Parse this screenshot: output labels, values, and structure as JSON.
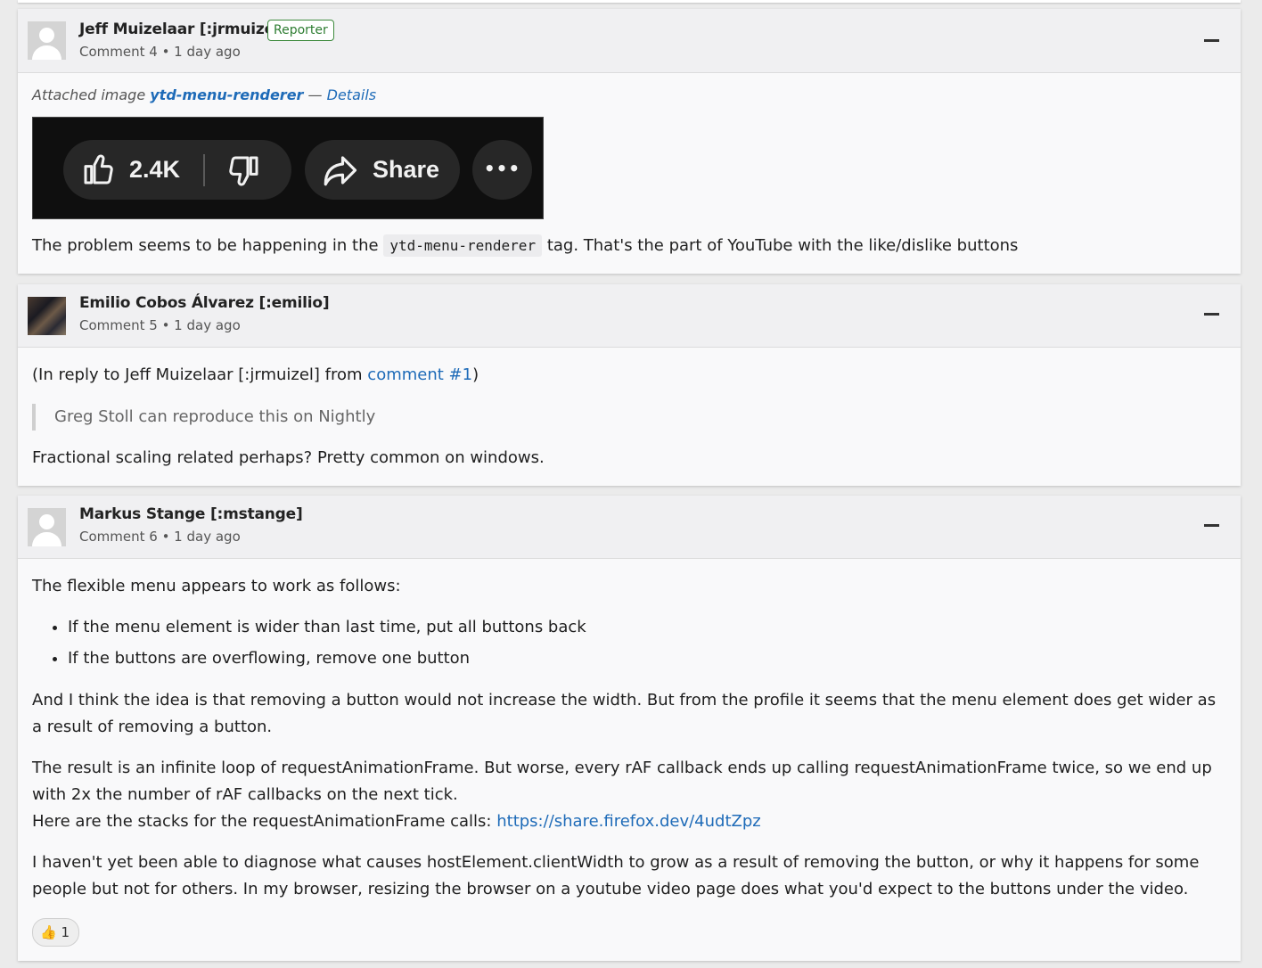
{
  "comment4": {
    "author": "Jeff Muizelaar [:jrmuizel]",
    "badge": "Reporter",
    "meta": "Comment 4 • 1 day ago",
    "attach_prefix": "Attached image",
    "attach_name": "ytd-menu-renderer",
    "attach_sep": "—",
    "attach_details": "Details",
    "image": {
      "like_count": "2.4K",
      "share_label": "Share",
      "more": "•••"
    },
    "body_before": "The problem seems to be happening in the",
    "body_code": "ytd-menu-renderer",
    "body_after": "tag. That's the part of YouTube with the like/dislike buttons"
  },
  "comment5": {
    "author": "Emilio Cobos Álvarez [:emilio]",
    "meta": "Comment 5 • 1 day ago",
    "reply_prefix": "(In reply to Jeff Muizelaar [:jrmuizel] from",
    "reply_link": "comment #1",
    "reply_suffix": ")",
    "quote": "Greg Stoll can reproduce this on Nightly",
    "body": "Fractional scaling related perhaps? Pretty common on windows."
  },
  "comment6": {
    "author": "Markus Stange [:mstange]",
    "meta": "Comment 6 • 1 day ago",
    "p1": "The flexible menu appears to work as follows:",
    "bullets": [
      "If the menu element is wider than last time, put all buttons back",
      "If the buttons are overflowing, remove one button"
    ],
    "p2": "And I think the idea is that removing a button would not increase the width. But from the profile it seems that the menu element does get wider as a result of removing a button.",
    "p3": "The result is an infinite loop of requestAnimationFrame. But worse, every rAF callback ends up calling requestAnimationFrame twice, so we end up with 2x the number of rAF callbacks on the next tick.",
    "p4_prefix": "Here are the stacks for the requestAnimationFrame calls:",
    "p4_link": "https://share.firefox.dev/4udtZpz",
    "p5": "I haven't yet been able to diagnose what causes hostElement.clientWidth to grow as a result of removing the button, or why it happens for some people but not for others. In my browser, resizing the browser on a youtube video page does what you'd expect to the buttons under the video.",
    "reaction_emoji": "👍",
    "reaction_count": "1"
  }
}
